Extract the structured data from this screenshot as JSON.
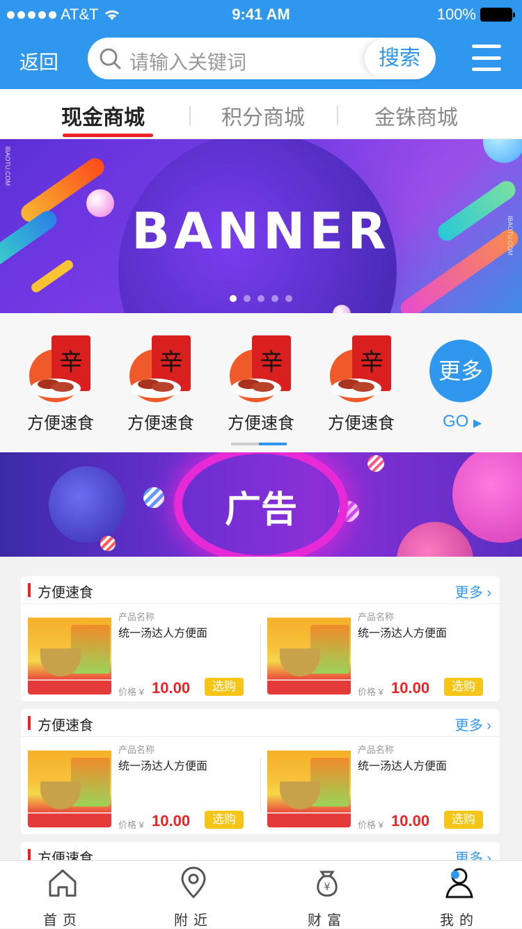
{
  "status_bar": {
    "carrier": "AT&T",
    "time": "9:41 AM",
    "battery": "100%"
  },
  "nav": {
    "back": "返回",
    "search_placeholder": "请输入关键词",
    "search_button": "搜索"
  },
  "tabs": [
    {
      "label": "现金商城",
      "active": true
    },
    {
      "label": "积分商城",
      "active": false
    },
    {
      "label": "金铢商城",
      "active": false
    }
  ],
  "banner": {
    "title": "BANNER",
    "slides": 5,
    "active_slide": 1,
    "side_text": "IBAOTU.COM"
  },
  "categories": [
    {
      "label": "方便速食"
    },
    {
      "label": "方便速食"
    },
    {
      "label": "方便速食"
    },
    {
      "label": "方便速食"
    }
  ],
  "more": {
    "label": "更多",
    "go": "GO"
  },
  "ad": {
    "text": "广告"
  },
  "sections": [
    {
      "title": "方便速食",
      "more": "更多",
      "products": [
        {
          "meta": "产品名称",
          "name": "统一汤达人方便面",
          "price_label": "价格 ¥",
          "price": "10.00",
          "buy": "选购"
        },
        {
          "meta": "产品名称",
          "name": "统一汤达人方便面",
          "price_label": "价格 ¥",
          "price": "10.00",
          "buy": "选购"
        }
      ]
    },
    {
      "title": "方便速食",
      "more": "更多",
      "products": [
        {
          "meta": "产品名称",
          "name": "统一汤达人方便面",
          "price_label": "价格 ¥",
          "price": "10.00",
          "buy": "选购"
        },
        {
          "meta": "产品名称",
          "name": "统一汤达人方便面",
          "price_label": "价格 ¥",
          "price": "10.00",
          "buy": "选购"
        }
      ]
    },
    {
      "title": "方便速食",
      "more": "更多",
      "products": []
    }
  ],
  "tabbar": [
    {
      "label": "首页",
      "icon": "home-icon"
    },
    {
      "label": "附近",
      "icon": "location-icon"
    },
    {
      "label": "财富",
      "icon": "money-bag-icon"
    },
    {
      "label": "我的",
      "icon": "user-icon"
    }
  ],
  "colors": {
    "primary": "#2f97ee",
    "accent_red": "#e22222",
    "buy_yellow": "#f5c518"
  }
}
